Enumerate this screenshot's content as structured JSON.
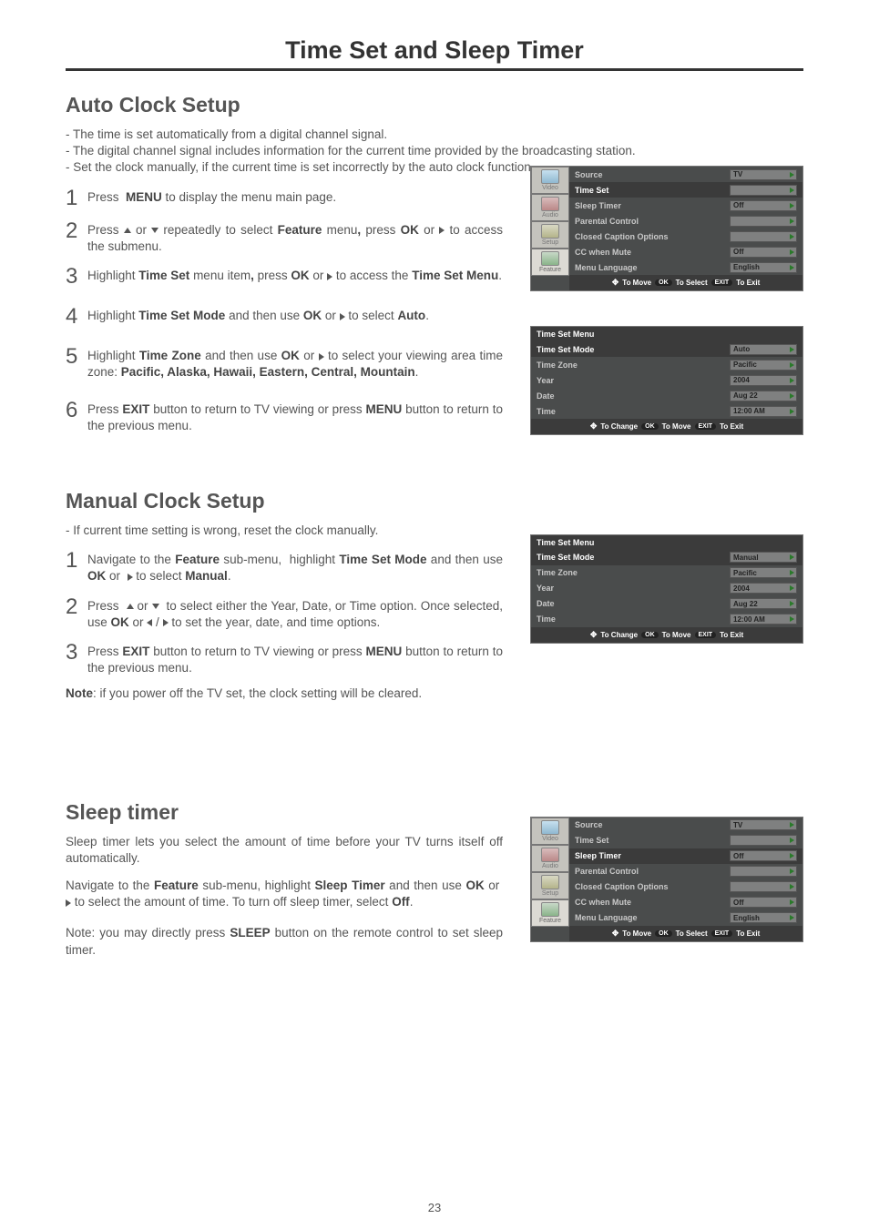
{
  "page": {
    "title": "Time Set and Sleep Timer",
    "pageNumber": "23"
  },
  "autoClock": {
    "heading": "Auto Clock Setup",
    "intro": [
      "- The time is set automatically from a digital channel signal.",
      "- The digital channel signal includes information for the current time provided by the broadcasting station.",
      "- Set the clock manually, if the current time is set incorrectly by the auto clock function."
    ],
    "steps": {
      "s1": "Press MENU to display the menu main page.",
      "s2a": "Press ",
      "s2b": " or ",
      "s2c": " repeatedly to select Feature menu, press OK or ",
      "s2d": " to access the submenu.",
      "s3a": "Highlight Time Set menu item, press OK or ",
      "s3b": " to access the Time Set Menu.",
      "s4a": "Highlight Time Set Mode and then use OK or ",
      "s4b": " to select Auto.",
      "s5a": "Highlight Time Zone and then use OK or ",
      "s5b": " to select your viewing area time zone: Pacific, Alaska, Hawaii, Eastern, Central, Mountain.",
      "s6": "Press EXIT button to return to TV viewing or press MENU button to return to the previous menu."
    }
  },
  "manualClock": {
    "heading": "Manual Clock Setup",
    "intro": "- If current time setting is wrong, reset the clock manually.",
    "steps": {
      "s1a": "Navigate to the Feature sub-menu, highlight Time Set Mode and then use OK or ",
      "s1b": " to select Manual.",
      "s2a": "Press ",
      "s2b": " or ",
      "s2c": " to select either the Year, Date, or Time option. Once selected, use OK or ",
      "s2d": " / ",
      "s2e": " to set the year, date, and time options.",
      "s3": "Press EXIT button to return to TV viewing or press MENU button to return to the previous menu."
    },
    "note": "Note: if you power off the TV set, the clock setting will be cleared."
  },
  "sleepTimer": {
    "heading": "Sleep timer",
    "p1": "Sleep timer lets you select the amount of time before your TV turns itself off automatically.",
    "p2a": "Navigate to the Feature sub-menu, highlight Sleep Timer and then use OK or ",
    "p2b": " to select the amount of time. To turn off sleep timer, select Off.",
    "p3": "Note: you may directly press SLEEP button on the remote control to set sleep timer."
  },
  "osd": {
    "sideLabels": {
      "video": "Video",
      "audio": "Audio",
      "setup": "Setup",
      "feature": "Feature"
    },
    "featureMenu": {
      "source": "Source",
      "sourceVal": "TV",
      "timeSet": "Time Set",
      "sleepTimer": "Sleep Timer",
      "sleepTimerVal": "Off",
      "parental": "Parental Control",
      "cco": "Closed Caption Options",
      "ccMute": "CC when Mute",
      "ccMuteVal": "Off",
      "menuLang": "Menu Language",
      "menuLangVal": "English",
      "footerMove": "To Move",
      "footerOK": "OK",
      "footerSelect": "To Select",
      "footerExit": "EXIT",
      "footerExitLbl": "To Exit"
    },
    "timeSetMenu": {
      "title": "Time Set Menu",
      "mode": "Time Set Mode",
      "modeValAuto": "Auto",
      "modeValManual": "Manual",
      "zone": "Time Zone",
      "zoneVal": "Pacific",
      "year": "Year",
      "yearVal": "2004",
      "date": "Date",
      "dateVal": "Aug 22",
      "time": "Time",
      "timeVal": "12:00  AM",
      "footerChange": "To Change",
      "footerMove": "To Move",
      "footerExit": "To Exit"
    }
  }
}
